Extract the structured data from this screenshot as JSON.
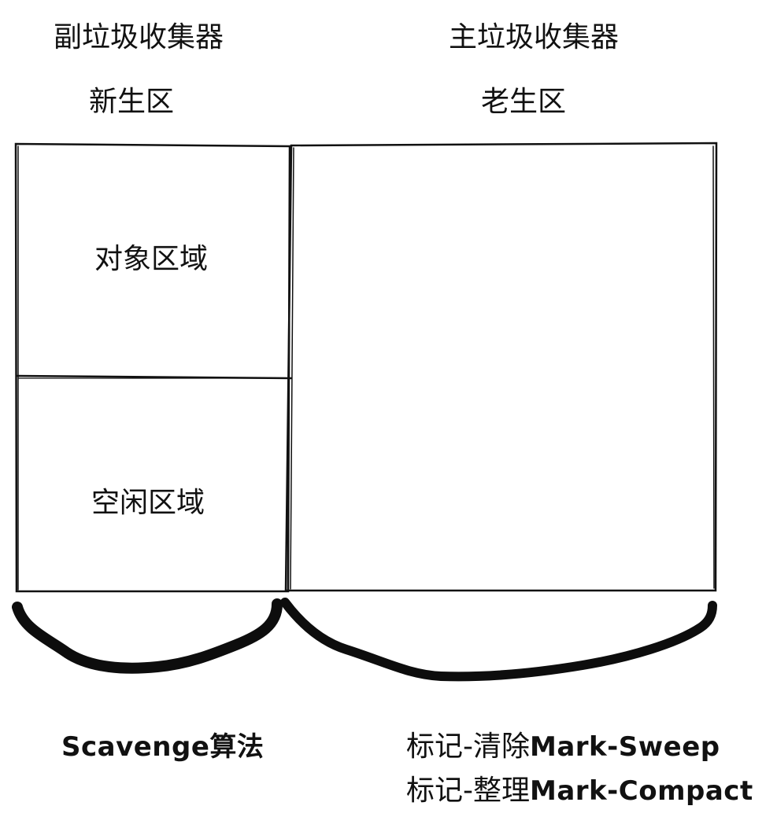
{
  "headers": {
    "minor_gc": "副垃圾收集器",
    "major_gc": "主垃圾收集器",
    "young_gen": "新生区",
    "old_gen": "老生区"
  },
  "regions": {
    "object_area": "对象区域",
    "free_area": "空闲区域"
  },
  "algorithms": {
    "scavenge": "Scavenge算法",
    "mark_sweep_prefix": "标记-清除",
    "mark_sweep_name": "Mark-Sweep",
    "mark_compact_prefix": "标记-整理",
    "mark_compact_name": "Mark-Compact"
  }
}
